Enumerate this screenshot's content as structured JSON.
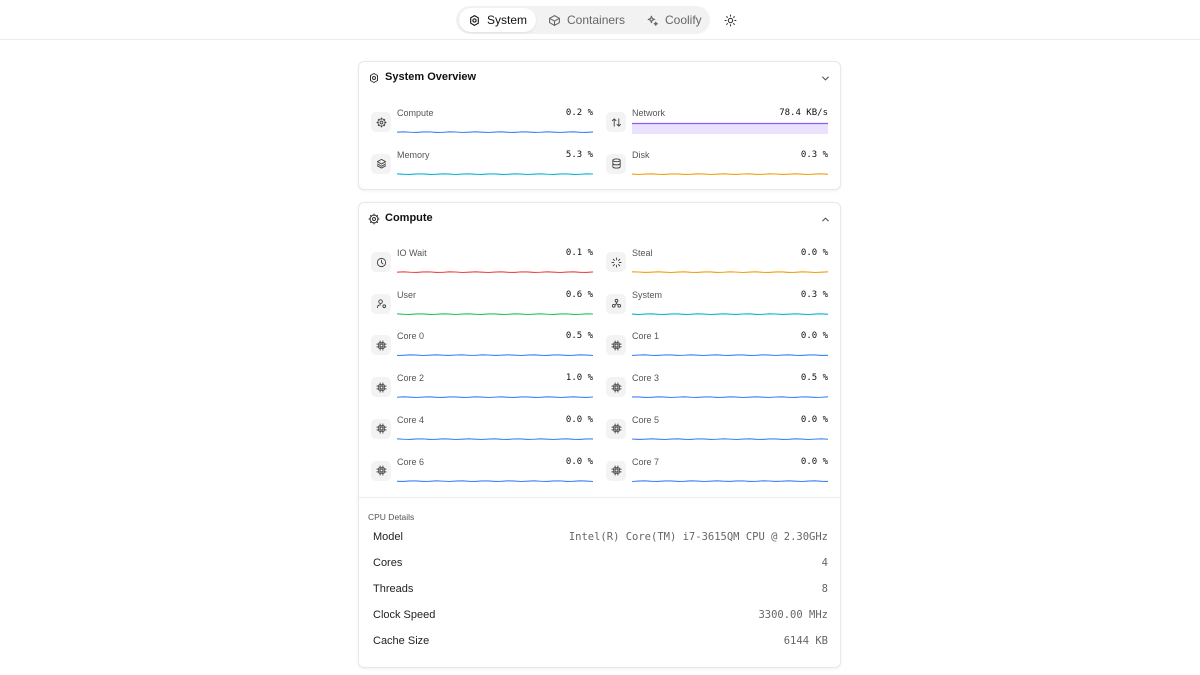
{
  "nav": {
    "tabs": [
      {
        "label": "System",
        "icon": "cpu-chip-icon",
        "active": true
      },
      {
        "label": "Containers",
        "icon": "box-icon",
        "active": false
      },
      {
        "label": "Coolify",
        "icon": "sparkles-icon",
        "active": false
      }
    ],
    "theme_icon": "sun-icon"
  },
  "overview": {
    "title": "System Overview",
    "metrics": [
      {
        "label": "Compute",
        "value": "0.2 %",
        "icon": "gear-icon",
        "color": "#3b82f6"
      },
      {
        "label": "Network",
        "value": "78.4 KB/s",
        "icon": "arrows-up-down-icon",
        "color": "#8b5cf6"
      },
      {
        "label": "Memory",
        "value": "5.3 %",
        "icon": "layers-icon",
        "color": "#06b6d4"
      },
      {
        "label": "Disk",
        "value": "0.3 %",
        "icon": "database-icon",
        "color": "#f59e0b"
      }
    ]
  },
  "compute": {
    "title": "Compute",
    "metrics": [
      {
        "label": "IO Wait",
        "value": "0.1 %",
        "icon": "clock-icon",
        "color": "#ef4444"
      },
      {
        "label": "Steal",
        "value": "0.0 %",
        "icon": "loader-icon",
        "color": "#f59e0b"
      },
      {
        "label": "User",
        "value": "0.6 %",
        "icon": "user-icon",
        "color": "#22c55e"
      },
      {
        "label": "System",
        "value": "0.3 %",
        "icon": "cluster-icon",
        "color": "#06b6d4"
      },
      {
        "label": "Core 0",
        "value": "0.5 %",
        "icon": "chip-icon",
        "color": "#3b82f6"
      },
      {
        "label": "Core 1",
        "value": "0.0 %",
        "icon": "chip-icon",
        "color": "#3b82f6"
      },
      {
        "label": "Core 2",
        "value": "1.0 %",
        "icon": "chip-icon",
        "color": "#3b82f6"
      },
      {
        "label": "Core 3",
        "value": "0.5 %",
        "icon": "chip-icon",
        "color": "#3b82f6"
      },
      {
        "label": "Core 4",
        "value": "0.0 %",
        "icon": "chip-icon",
        "color": "#3b82f6"
      },
      {
        "label": "Core 5",
        "value": "0.0 %",
        "icon": "chip-icon",
        "color": "#3b82f6"
      },
      {
        "label": "Core 6",
        "value": "0.0 %",
        "icon": "chip-icon",
        "color": "#3b82f6"
      },
      {
        "label": "Core 7",
        "value": "0.0 %",
        "icon": "chip-icon",
        "color": "#3b82f6"
      }
    ],
    "cpu_details_title": "CPU Details",
    "cpu_details": [
      {
        "key": "Model",
        "value": "Intel(R) Core(TM) i7-3615QM CPU @ 2.30GHz"
      },
      {
        "key": "Cores",
        "value": "4"
      },
      {
        "key": "Threads",
        "value": "8"
      },
      {
        "key": "Clock Speed",
        "value": "3300.00 MHz"
      },
      {
        "key": "Cache Size",
        "value": "6144 KB"
      }
    ]
  }
}
